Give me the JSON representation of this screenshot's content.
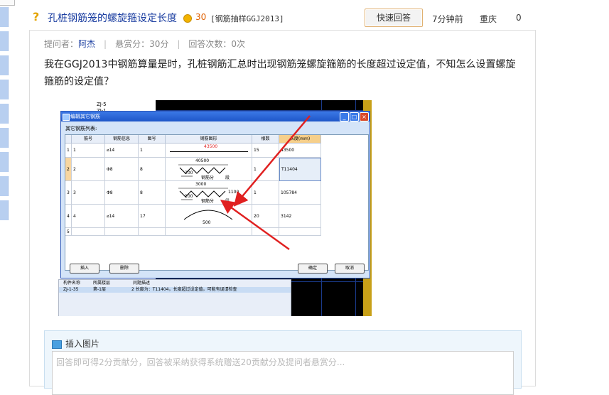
{
  "question": {
    "title": "孔桩钢筋笼的螺旋箍设定长度",
    "score": "30",
    "category": "[钢筋抽样GGJ2013]",
    "quick_answer_label": "快速回答",
    "time": "7分钟前",
    "city": "重庆",
    "answer_count": "0"
  },
  "meta": {
    "asker_label": "提问者：",
    "asker": "阿杰",
    "bounty": "悬赏分：30分",
    "answers": "回答次数：0次"
  },
  "body_text": "我在GGJ2013中钢筋算量是时，孔桩钢筋汇总时出现钢筋笼螺旋箍筋的长度超过设定值，不知怎么设置螺旋箍筋的设定值？",
  "screenshot": {
    "tree_items": [
      "ZJ-5",
      "ZJ-1"
    ],
    "dialog_title": "编辑其它钢筋",
    "list_label": "其它钢筋列表:",
    "columns": [
      "筋号",
      "钢筋信息",
      "图号",
      "钢筋图形",
      "根数",
      "长度(mm)"
    ],
    "rows": [
      {
        "n": "1",
        "no": "1",
        "info": "⌀14",
        "fig": "1",
        "shape_label": "43500",
        "count": "15",
        "length": "43500"
      },
      {
        "n": "2",
        "no": "2",
        "info": "Φ8",
        "fig": "8",
        "shape_label": "40500",
        "count": "1",
        "length": "T11404"
      },
      {
        "n": "3",
        "no": "3",
        "info": "Φ8",
        "fig": "8",
        "shape_label": "3000",
        "count": "1",
        "length": "105784"
      },
      {
        "n": "4",
        "no": "4",
        "info": "⌀14",
        "fig": "17",
        "shape_label": "500",
        "count": "20",
        "length": "3142"
      },
      {
        "n": "5",
        "no": "",
        "info": "",
        "fig": "",
        "shape_label": "",
        "count": "",
        "length": ""
      }
    ],
    "shape_sub": {
      "row2_small": "200",
      "row2_seg": "钢筋分",
      "row3_small": "100",
      "row3_side": "1100",
      "row3_seg": "钢筋分",
      "seg": "段"
    },
    "buttons": {
      "insert": "插入",
      "delete": "删除",
      "ok": "确定",
      "cancel": "取消"
    },
    "lower_headers": [
      "构件名称",
      "所属楼层",
      "问题描述"
    ],
    "lower_row": {
      "name": "ZJ-1-35",
      "floor": "第-1层",
      "desc": "2 长度为：T11404，长度超过设定值，可能有误请检查"
    }
  },
  "reply": {
    "insert_image": "插入图片",
    "placeholder": "回答即可得2分贡献分，回答被采纳获得系统赠送20贡献分及提问者悬赏分..."
  },
  "colors": {
    "title_link": "#1a3da0",
    "score": "#e06000",
    "arrow": "#e02020",
    "accent_border": "#e0b070"
  }
}
